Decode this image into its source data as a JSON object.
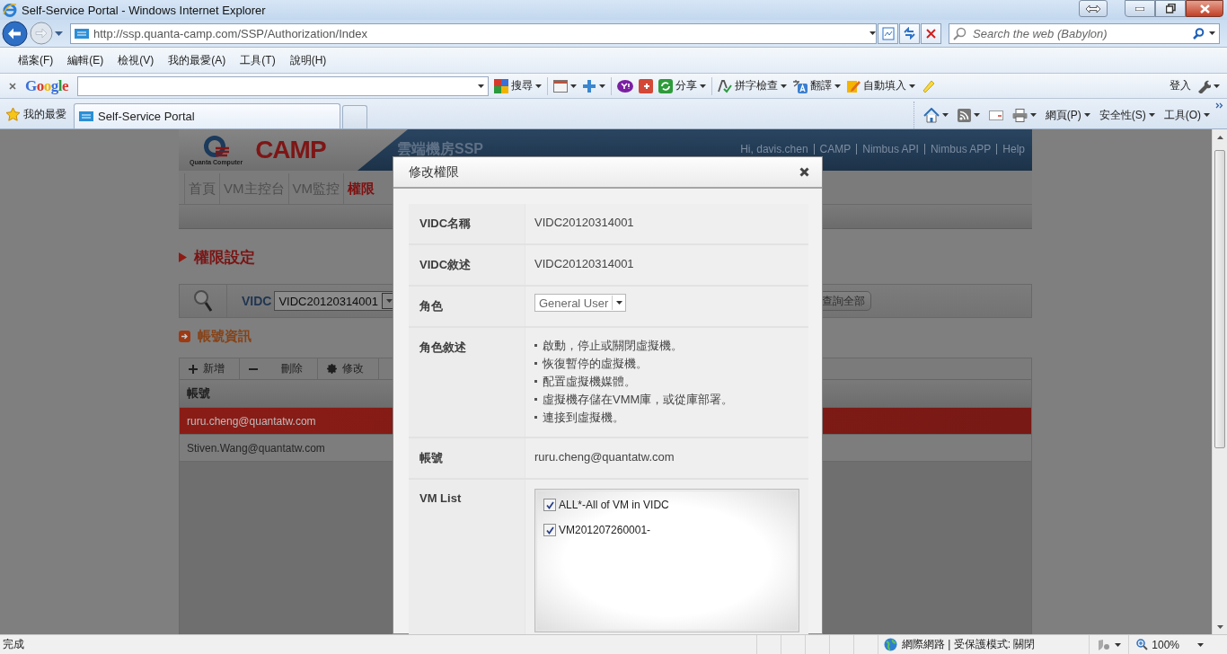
{
  "window": {
    "title": "Self-Service Portal - Windows Internet Explorer"
  },
  "address_bar": {
    "url": "http://ssp.quanta-camp.com/SSP/Authorization/Index"
  },
  "search": {
    "placeholder": "Search the web (Babylon)"
  },
  "menu_bar": [
    "檔案(F)",
    "編輯(E)",
    "檢視(V)",
    "我的最愛(A)",
    "工具(T)",
    "說明(H)"
  ],
  "google_toolbar": {
    "logo": "Google",
    "search": "搜尋",
    "share": "分享",
    "spellcheck": "拼字檢查",
    "translate": "翻譯",
    "autofill": "自動填入",
    "sign_in": "登入"
  },
  "favorites_bar": {
    "favorites": "我的最愛",
    "tabs": [
      {
        "title": "Self-Service Portal",
        "selected": true
      }
    ]
  },
  "command_bar": {
    "page": "網頁(P)",
    "safety": "安全性(S)",
    "tools": "工具(O)"
  },
  "page": {
    "header": {
      "brand": "CAMP",
      "company": "Quanta Computer",
      "title": "雲端機房SSP",
      "links": [
        "Hi, davis.chen",
        "CAMP",
        "Nimbus API",
        "Nimbus APP",
        "Help"
      ]
    },
    "nav_tabs": [
      {
        "label": "首頁",
        "selected": false
      },
      {
        "label": "VM主控台",
        "selected": false
      },
      {
        "label": "VM監控",
        "selected": false
      },
      {
        "label": "權限",
        "selected": true
      }
    ],
    "section_title": "權限設定",
    "filter": {
      "label": "VIDC",
      "value": "VIDC20120314001",
      "button": "查詢全部"
    },
    "accounts": {
      "title": "帳號資訊",
      "actions": [
        {
          "label": "新增",
          "kind": "add"
        },
        {
          "label": "刪除",
          "kind": "remove"
        },
        {
          "label": "修改",
          "kind": "edit"
        }
      ],
      "columns": [
        "帳號"
      ],
      "rows": [
        {
          "account": "ruru.cheng@quantatw.com",
          "selected": true
        },
        {
          "account": "Stiven.Wang@quantatw.com",
          "selected": false
        }
      ]
    }
  },
  "dialog": {
    "title": "修改權限",
    "fields": [
      {
        "label": "VIDC名稱",
        "kind": "text",
        "value": "VIDC20120314001"
      },
      {
        "label": "VIDC敘述",
        "kind": "text",
        "value": "VIDC20120314001"
      },
      {
        "label": "角色",
        "kind": "select",
        "value": "General User",
        "disabled": true
      },
      {
        "label": "角色敘述",
        "kind": "bullets",
        "items": [
          "啟動，停止或關閉虛擬機。",
          "恢復暫停的虛擬機。",
          "配置虛擬機媒體。",
          "虛擬機存儲在VMM庫，或從庫部署。",
          "連接到虛擬機。"
        ]
      },
      {
        "label": "帳號",
        "kind": "text",
        "value": "ruru.cheng@quantatw.com"
      },
      {
        "label": "VM List",
        "kind": "checklist",
        "options": [
          {
            "label": "ALL*-All of VM in VIDC",
            "checked": true
          },
          {
            "label": "VM201207260001-",
            "checked": true
          }
        ]
      }
    ]
  },
  "status_bar": {
    "status": "完成",
    "zone": "網際網路 | 受保護模式: 關閉",
    "zoom": "100%"
  }
}
